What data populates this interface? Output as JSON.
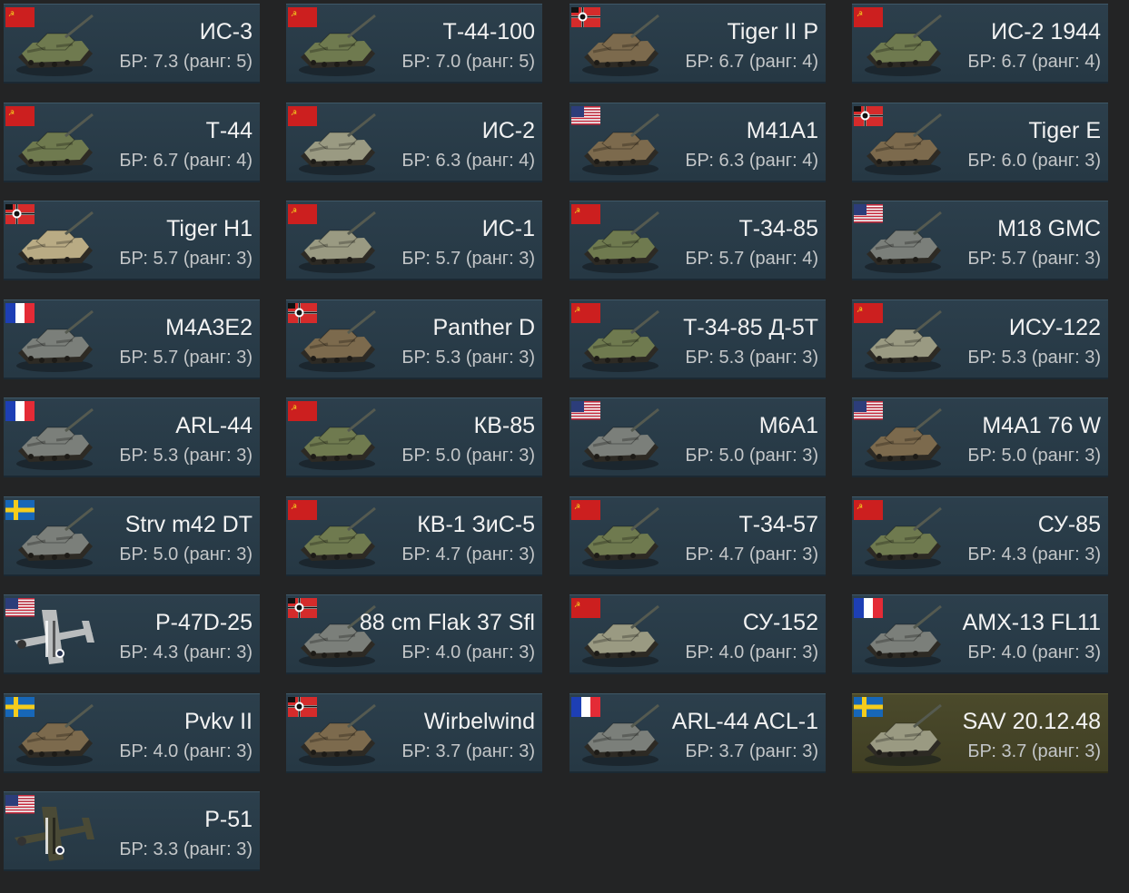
{
  "vehicles": [
    {
      "name": "ИС-3",
      "br": "БР: 7.3 (ранг: 5)",
      "nation": "ussr",
      "kind": "tank",
      "camo": "green",
      "premium": false
    },
    {
      "name": "Т-44-100",
      "br": "БР: 7.0 (ранг: 5)",
      "nation": "ussr",
      "kind": "tank",
      "camo": "green",
      "premium": false
    },
    {
      "name": "Tiger II P",
      "br": "БР: 6.7 (ранг: 4)",
      "nation": "germany",
      "kind": "tank",
      "camo": "brown",
      "premium": false
    },
    {
      "name": "ИС-2 1944",
      "br": "БР: 6.7 (ранг: 4)",
      "nation": "ussr",
      "kind": "tank",
      "camo": "green",
      "premium": false
    },
    {
      "name": "Т-44",
      "br": "БР: 6.7 (ранг: 4)",
      "nation": "ussr",
      "kind": "tank",
      "camo": "green",
      "premium": false
    },
    {
      "name": "ИС-2",
      "br": "БР: 6.3 (ранг: 4)",
      "nation": "ussr",
      "kind": "tank",
      "camo": "pale",
      "premium": false
    },
    {
      "name": "M41A1",
      "br": "БР: 6.3 (ранг: 4)",
      "nation": "usa",
      "kind": "tank",
      "camo": "brown",
      "premium": false
    },
    {
      "name": "Tiger E",
      "br": "БР: 6.0 (ранг: 3)",
      "nation": "germany",
      "kind": "tank",
      "camo": "brown",
      "premium": false
    },
    {
      "name": "Tiger H1",
      "br": "БР: 5.7 (ранг: 3)",
      "nation": "germany",
      "kind": "tank",
      "camo": "sand",
      "premium": false
    },
    {
      "name": "ИС-1",
      "br": "БР: 5.7 (ранг: 3)",
      "nation": "ussr",
      "kind": "tank",
      "camo": "pale",
      "premium": false
    },
    {
      "name": "Т-34-85",
      "br": "БР: 5.7 (ранг: 4)",
      "nation": "ussr",
      "kind": "tank",
      "camo": "green",
      "premium": false
    },
    {
      "name": "M18 GMC",
      "br": "БР: 5.7 (ранг: 3)",
      "nation": "usa",
      "kind": "tank",
      "camo": "grey",
      "premium": false
    },
    {
      "name": "M4A3E2",
      "br": "БР: 5.7 (ранг: 3)",
      "nation": "france",
      "kind": "tank",
      "camo": "grey",
      "premium": false
    },
    {
      "name": "Panther D",
      "br": "БР: 5.3 (ранг: 3)",
      "nation": "germany",
      "kind": "tank",
      "camo": "brown",
      "premium": false
    },
    {
      "name": "Т-34-85 Д-5Т",
      "br": "БР: 5.3 (ранг: 3)",
      "nation": "ussr",
      "kind": "tank",
      "camo": "green",
      "premium": false
    },
    {
      "name": "ИСУ-122",
      "br": "БР: 5.3 (ранг: 3)",
      "nation": "ussr",
      "kind": "tank",
      "camo": "pale",
      "premium": false
    },
    {
      "name": "ARL-44",
      "br": "БР: 5.3 (ранг: 3)",
      "nation": "france",
      "kind": "tank",
      "camo": "grey",
      "premium": false
    },
    {
      "name": "КВ-85",
      "br": "БР: 5.0 (ранг: 3)",
      "nation": "ussr",
      "kind": "tank",
      "camo": "green",
      "premium": false
    },
    {
      "name": "M6A1",
      "br": "БР: 5.0 (ранг: 3)",
      "nation": "usa",
      "kind": "tank",
      "camo": "grey",
      "premium": false
    },
    {
      "name": "M4A1 76 W",
      "br": "БР: 5.0 (ранг: 3)",
      "nation": "usa",
      "kind": "tank",
      "camo": "brown",
      "premium": false
    },
    {
      "name": "Strv m42 DT",
      "br": "БР: 5.0 (ранг: 3)",
      "nation": "sweden",
      "kind": "tank",
      "camo": "grey",
      "premium": false
    },
    {
      "name": "КВ-1 ЗиС-5",
      "br": "БР: 4.7 (ранг: 3)",
      "nation": "ussr",
      "kind": "tank",
      "camo": "green",
      "premium": false
    },
    {
      "name": "Т-34-57",
      "br": "БР: 4.7 (ранг: 3)",
      "nation": "ussr",
      "kind": "tank",
      "camo": "green",
      "premium": false
    },
    {
      "name": "СУ-85",
      "br": "БР: 4.3 (ранг: 3)",
      "nation": "ussr",
      "kind": "tank",
      "camo": "green",
      "premium": false
    },
    {
      "name": "P-47D-25",
      "br": "БР: 4.3 (ранг: 3)",
      "nation": "usa",
      "kind": "plane",
      "camo": "silver",
      "premium": false
    },
    {
      "name": "88 cm Flak 37 Sfl",
      "br": "БР: 4.0 (ранг: 3)",
      "nation": "germany",
      "kind": "tank",
      "camo": "grey",
      "premium": false
    },
    {
      "name": "СУ-152",
      "br": "БР: 4.0 (ранг: 3)",
      "nation": "ussr",
      "kind": "tank",
      "camo": "pale",
      "premium": false
    },
    {
      "name": "AMX-13 FL11",
      "br": "БР: 4.0 (ранг: 3)",
      "nation": "france",
      "kind": "tank",
      "camo": "grey",
      "premium": false
    },
    {
      "name": "Pvkv II",
      "br": "БР: 4.0 (ранг: 3)",
      "nation": "sweden",
      "kind": "tank",
      "camo": "brown",
      "premium": false
    },
    {
      "name": "Wirbelwind",
      "br": "БР: 3.7 (ранг: 3)",
      "nation": "germany",
      "kind": "tank",
      "camo": "brown",
      "premium": false
    },
    {
      "name": "ARL-44 ACL-1",
      "br": "БР: 3.7 (ранг: 3)",
      "nation": "france",
      "kind": "tank",
      "camo": "grey",
      "premium": false
    },
    {
      "name": "SAV 20.12.48",
      "br": "БР: 3.7 (ранг: 3)",
      "nation": "sweden",
      "kind": "tank",
      "camo": "pale",
      "premium": true
    },
    {
      "name": "P-51",
      "br": "БР: 3.3 (ранг: 3)",
      "nation": "usa",
      "kind": "plane",
      "camo": "olive",
      "premium": false
    }
  ],
  "camo_colors": {
    "green": "#6f7a4f",
    "pale": "#9a9a82",
    "brown": "#7c6a4d",
    "sand": "#b9ab84",
    "grey": "#7b7f7a",
    "silver": "#b9bcbd",
    "olive": "#4a4a36"
  }
}
